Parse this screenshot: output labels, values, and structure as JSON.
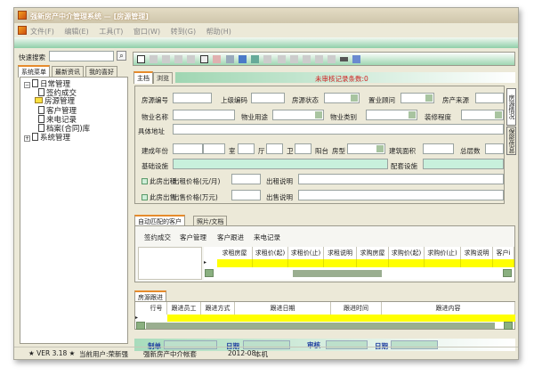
{
  "window": {
    "title": "强新房产中介管理系统 — [房源管理]"
  },
  "menu": [
    "文件(F)",
    "编辑(E)",
    "工具(T)",
    "窗口(W)",
    "转到(G)",
    "帮助(H)"
  ],
  "left": {
    "search_label": "快速搜索",
    "search_value": "",
    "tabs": [
      "系统菜单",
      "最新资讯",
      "我的喜好"
    ],
    "tree": {
      "root": "日常管理",
      "children": [
        "签约成交",
        "房源管理",
        "客户管理",
        "来电记录",
        "档案(合同)库"
      ],
      "root2": "系统管理"
    }
  },
  "tabs": [
    "主档",
    "浏览"
  ],
  "unreviewed": "未审核记录条数:0",
  "form": {
    "f_code": "房源编号",
    "f_parent": "上级编码",
    "f_status": "房源状态",
    "f_agent": "置业顾问",
    "f_source": "房产来源",
    "f_name": "物业名称",
    "f_use": "物业用途",
    "f_type": "物业类别",
    "f_deco": "装修程度",
    "f_addr": "具体地址",
    "f_year": "建成年份",
    "f_room": "室",
    "f_hall": "厅",
    "f_bath": "卫",
    "f_balcony": "阳台",
    "f_layout": "房型",
    "f_area": "建筑面积",
    "f_floors": "总层数",
    "f_infra": "基础设施",
    "f_facility": "配套设施",
    "rent_chk": "此房出租",
    "rent_price": "出租价格(元/月)",
    "rent_note": "出租说明",
    "sale_chk": "此房出售",
    "sale_price": "出售价格(万元)",
    "sale_note": "出售说明"
  },
  "side_tabs": [
    "房源情况",
    "保密信息"
  ],
  "match": {
    "tabs": [
      "自动匹配的客户",
      "照片/文档"
    ],
    "buttons": [
      "签约成交",
      "客户管理",
      "客户跟进",
      "来电记录"
    ],
    "columns": [
      "求租房屋",
      "求租价(起)",
      "求租价(止)",
      "求租说明",
      "求购房屋",
      "求购价(起)",
      "求购价(止)",
      "求购说明",
      "客户i"
    ]
  },
  "follow": {
    "tab": "房源跟进",
    "columns": [
      "行号",
      "跟进员工",
      "跟进方式",
      "跟进日期",
      "跟进时间",
      "跟进内容"
    ]
  },
  "footer": {
    "maker": "制单",
    "date1": "日期",
    "review": "审核",
    "date2": "日期"
  },
  "status": {
    "version": "★ VER 3.18 ★",
    "user": "当前用户:荣新强",
    "account": "强新房产中介帐套",
    "period": "2012-08",
    "host": "本机"
  }
}
